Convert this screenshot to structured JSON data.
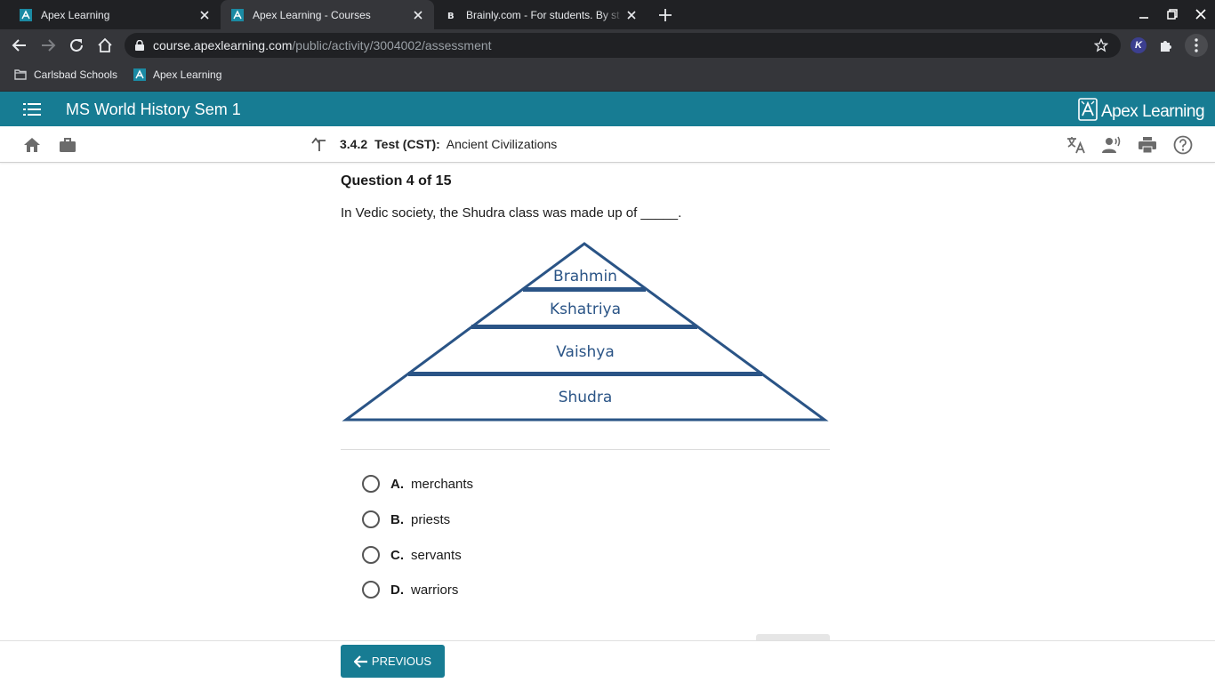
{
  "browser": {
    "tabs": [
      {
        "title": "Apex Learning",
        "icon": "apex-favicon",
        "active": false
      },
      {
        "title": "Apex Learning - Courses",
        "icon": "apex-favicon",
        "active": true
      },
      {
        "title": "Brainly.com - For students. By st",
        "icon": "brainly-favicon",
        "active": false
      }
    ],
    "url_host": "course.apexlearning.com",
    "url_path": "/public/activity/3004002/assessment",
    "extension_k_label": "K",
    "bookmarks": [
      {
        "label": "Carlsbad Schools",
        "icon": "folder-icon"
      },
      {
        "label": "Apex Learning",
        "icon": "apex-favicon"
      }
    ]
  },
  "header": {
    "course_title": "MS World History Sem 1",
    "logo_text": "Apex Learning"
  },
  "subnav": {
    "activity_number": "3.4.2",
    "activity_type": "Test (CST):",
    "activity_title": "Ancient Civilizations"
  },
  "question": {
    "number_label": "Question 4 of 15",
    "text": "In Vedic society, the Shudra class was made up of _____.",
    "diagram_labels": [
      "Brahmin",
      "Kshatriya",
      "Vaishya",
      "Shudra"
    ],
    "options": [
      {
        "letter": "A.",
        "text": "merchants"
      },
      {
        "letter": "B.",
        "text": "priests"
      },
      {
        "letter": "C.",
        "text": "servants"
      },
      {
        "letter": "D.",
        "text": "warriors"
      }
    ]
  },
  "footer": {
    "previous_label": "PREVIOUS"
  },
  "colors": {
    "brand_teal": "#177c93",
    "pyramid_stroke": "#2a5486",
    "chrome_dark": "#202124",
    "chrome_toolbar": "#35363a"
  }
}
